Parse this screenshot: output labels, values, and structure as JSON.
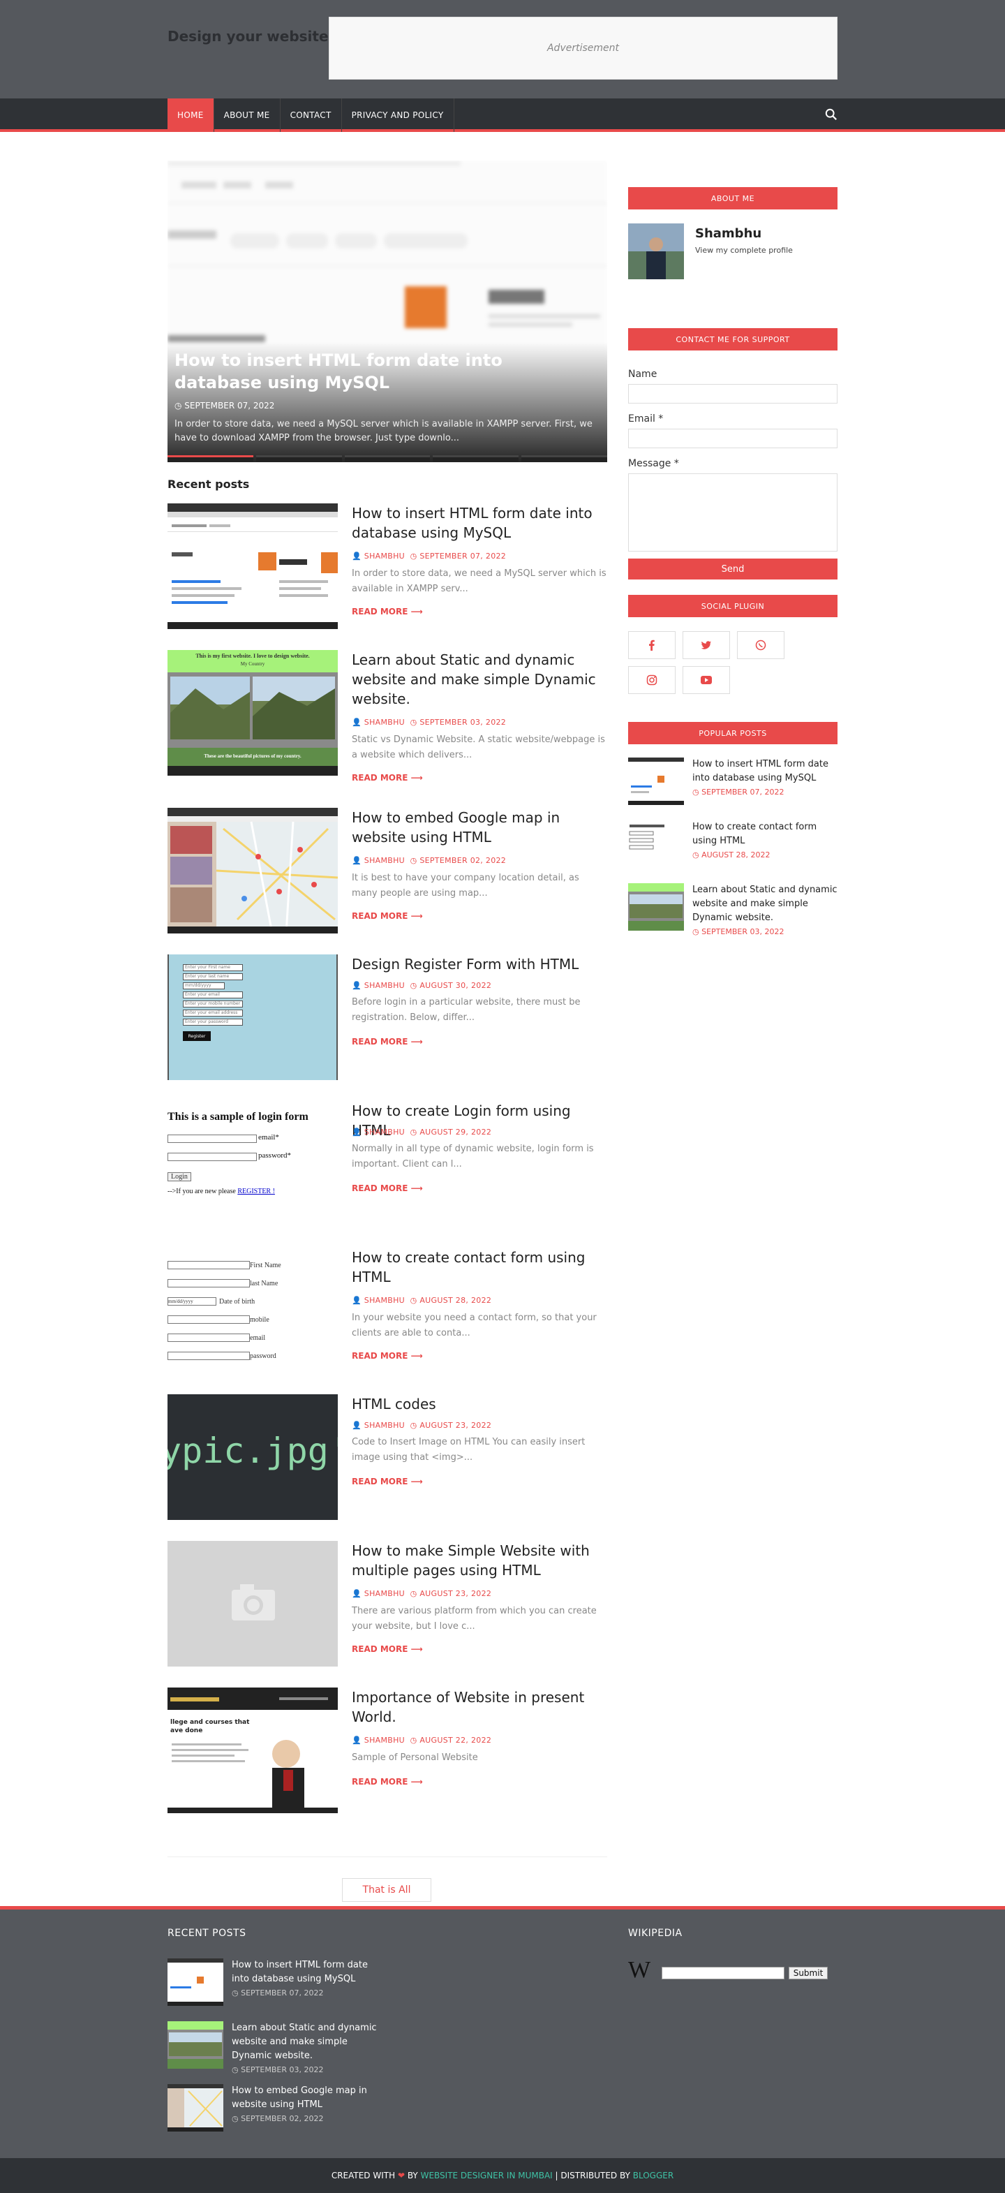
{
  "header": {
    "site_title": "Design your website",
    "ad_label": "Advertisement"
  },
  "nav": {
    "items": [
      "HOME",
      "ABOUT ME",
      "CONTACT",
      "PRIVACY AND POLICY"
    ],
    "search_icon": "search-icon"
  },
  "slider": {
    "title": "How to insert HTML form date into database using MySQL",
    "date": "SEPTEMBER 07, 2022",
    "excerpt": "In order to store data, we need a MySQL server which is available in XAMPP server. First, we have to download XAMPP from the browser. Just type downlo..."
  },
  "recent_title": "Recent posts",
  "posts": [
    {
      "title": "How to insert HTML form date into database using MySQL",
      "author": "SHAMBHU",
      "date": "SEPTEMBER 07, 2022",
      "excerpt": "In order to store data, we need a MySQL server which is available in XAMPP serv...",
      "more": "READ MORE"
    },
    {
      "title": "Learn about Static and dynamic website and make simple Dynamic website.",
      "author": "SHAMBHU",
      "date": "SEPTEMBER 03, 2022",
      "excerpt": "Static vs Dynamic Website. A static website/webpage is a website which delivers...",
      "more": "READ MORE"
    },
    {
      "title": "How to embed Google map in website using HTML",
      "author": "SHAMBHU",
      "date": "SEPTEMBER 02, 2022",
      "excerpt": "It is best to have your company location detail, as many people are using map...",
      "more": "READ MORE"
    },
    {
      "title": "Design Register Form with HTML",
      "author": "SHAMBHU",
      "date": "AUGUST 30, 2022",
      "excerpt": "Before login in a particular website, there must be registration. Below, differ...",
      "more": "READ MORE"
    },
    {
      "title": "How to create Login form using HTML",
      "author": "SHAMBHU",
      "date": "AUGUST 29, 2022",
      "excerpt": "Normally in all type of dynamic website, login form is important. Client can l...",
      "more": "READ MORE"
    },
    {
      "title": "How to create contact form using HTML",
      "author": "SHAMBHU",
      "date": "AUGUST 28, 2022",
      "excerpt": "In your website you need a contact form, so that your clients are able to conta...",
      "more": "READ MORE"
    },
    {
      "title": "HTML codes",
      "author": "SHAMBHU",
      "date": "AUGUST 23, 2022",
      "excerpt": "Code to Insert Image on HTML You can easily insert image using that <img>...",
      "more": "READ MORE"
    },
    {
      "title": "How to make Simple Website with multiple pages using HTML",
      "author": "SHAMBHU",
      "date": "AUGUST 23, 2022",
      "excerpt": "There are various platform from which you can create your website, but I love c...",
      "more": "READ MORE"
    },
    {
      "title": "Importance of Website in present World.",
      "author": "SHAMBHU",
      "date": "AUGUST 22, 2022",
      "excerpt": "Sample of Personal Website",
      "more": "READ MORE"
    }
  ],
  "thumb_text": {
    "login_heading": "This is a sample of login form",
    "login_email": "email*",
    "login_password": "password*",
    "login_button": "Login",
    "login_register_prefix": "-->If you are new please",
    "login_register_link": "REGISTER !",
    "contact_fields": [
      "First Name",
      "last Name",
      "Date of birth",
      "mobile",
      "email",
      "password"
    ],
    "code_text": "ypic.jpg'",
    "static_heading": "This is my first website. I love to design website.",
    "static_sub": "My Country",
    "static_footer": "These are the beautiful pictures of my country.",
    "register_fields": [
      "Enter your First name",
      "Enter your last name",
      "mm/dd/yyyy",
      "Enter your email",
      "Enter your mobile number",
      "Enter your email address",
      "Enter your password"
    ],
    "register_button": "Register",
    "importance_heading": "llege and courses that\nave done",
    "date_placeholder": "mm/dd/yyyy"
  },
  "pager_label": "That is All",
  "sidebar": {
    "about_title": "ABOUT ME",
    "author_name": "Shambhu",
    "profile_link": "View my complete profile",
    "contact_title": "CONTACT ME FOR SUPPORT",
    "name_label": "Name",
    "email_label": "Email *",
    "message_label": "Message *",
    "send_label": "Send",
    "social_title": "SOCIAL PLUGIN",
    "social_icons": [
      "facebook-icon",
      "twitter-icon",
      "whatsapp-icon",
      "instagram-icon",
      "youtube-icon"
    ],
    "popular_title": "POPULAR POSTS",
    "popular": [
      {
        "title": "How to insert HTML form date into database using MySQL",
        "date": "SEPTEMBER 07, 2022"
      },
      {
        "title": "How to create contact form using HTML",
        "date": "AUGUST 28, 2022"
      },
      {
        "title": "Learn about Static and dynamic website and make simple Dynamic website.",
        "date": "SEPTEMBER 03, 2022"
      }
    ]
  },
  "footer": {
    "recent_title": "RECENT POSTS",
    "wiki_title": "WIKIPEDIA",
    "wiki_submit": "Submit",
    "recent": [
      {
        "title": "How to insert HTML form date into database using MySQL",
        "date": "SEPTEMBER 07, 2022"
      },
      {
        "title": "Learn about Static and dynamic website and make simple Dynamic website.",
        "date": "SEPTEMBER 03, 2022"
      },
      {
        "title": "How to embed Google map in website using HTML",
        "date": "SEPTEMBER 02, 2022"
      }
    ],
    "credit_prefix": "CREATED WITH",
    "credit_by": "BY",
    "credit_designer": "WEBSITE DESIGNER IN MUMBAI",
    "credit_dist": "| DISTRIBUTED BY",
    "credit_blogger": "BLOGGER"
  },
  "colors": {
    "accent": "#e84a4a",
    "header_bg": "#55585d",
    "nav_bg": "#2f3236"
  }
}
